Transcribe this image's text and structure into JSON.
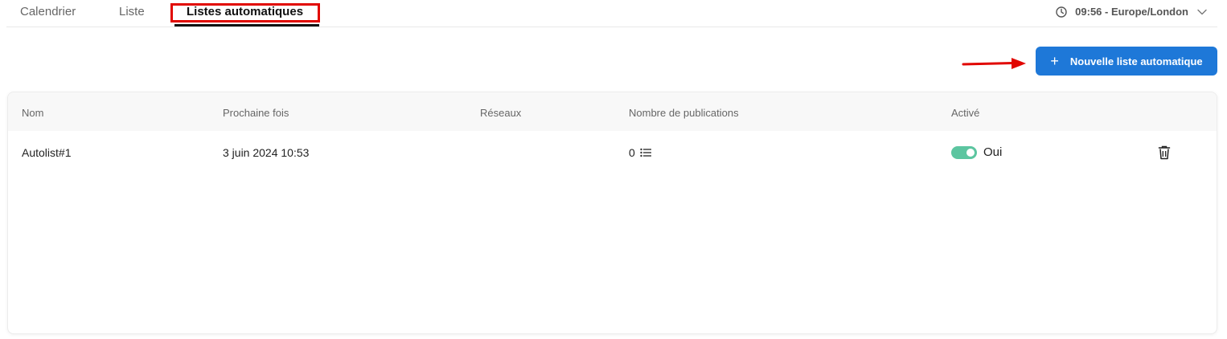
{
  "tabs": [
    {
      "label": "Calendrier"
    },
    {
      "label": "Liste"
    },
    {
      "label": "Listes automatiques",
      "active": true
    }
  ],
  "timezone": {
    "label": "09:56 - Europe/London",
    "icon": "clock-icon"
  },
  "new_button": {
    "label": "Nouvelle liste automatique",
    "icon": "plus-icon"
  },
  "colors": {
    "accent": "#1e78d8",
    "toggle_on": "#5cc5a0",
    "highlight": "#e10600"
  },
  "table": {
    "columns": [
      "Nom",
      "Prochaine fois",
      "Réseaux",
      "Nombre de publications",
      "Activé"
    ],
    "rows": [
      {
        "nom": "Autolist#1",
        "prochaine_fois": "3 juin 2024 10:53",
        "reseaux": "",
        "publications": "0",
        "active": true,
        "active_label": "Oui"
      }
    ]
  }
}
